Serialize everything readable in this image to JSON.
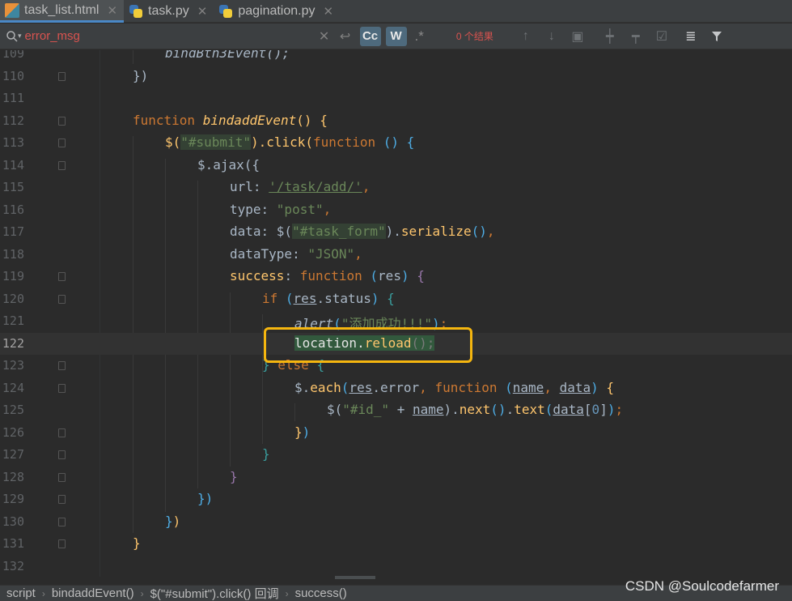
{
  "tabs": [
    {
      "label": "task_list.html",
      "icon": "html-file-icon",
      "active": true
    },
    {
      "label": "task.py",
      "icon": "python-file-icon",
      "active": false
    },
    {
      "label": "pagination.py",
      "icon": "python-file-icon",
      "active": false
    }
  ],
  "search": {
    "query": "error_msg",
    "match_case": "Cc",
    "whole_words": "W",
    "regex": ".*",
    "result_count": "0 个结果"
  },
  "editor": {
    "current_line": "122",
    "line_numbers": [
      "109",
      "110",
      "111",
      "112",
      "113",
      "114",
      "115",
      "116",
      "117",
      "118",
      "119",
      "120",
      "121",
      "122",
      "123",
      "124",
      "125",
      "126",
      "127",
      "128",
      "129",
      "130",
      "131",
      "132"
    ],
    "code": {
      "l109": "bindBtn3Event();",
      "l110": "})",
      "l112_kw": "function",
      "l112_name": "bindaddEvent",
      "l112_rest": "() {",
      "l113_a": "$(",
      "l113_str": "\"#submit\"",
      "l113_b": ").click(",
      "l113_kw": "function",
      "l113_c": " () {",
      "l114": "$.ajax({",
      "l115_key": "url",
      "l115_str": "'/task/add/'",
      "l116_key": "type",
      "l116_str": "\"post\"",
      "l117_key": "data",
      "l117_str": "\"#task_form\"",
      "l117_fn": "serialize",
      "l118_key": "dataType",
      "l118_str": "\"JSON\"",
      "l119_key": "success",
      "l119_kw": "function",
      "l119_param": "res",
      "l120_kw": "if",
      "l120_obj": "res",
      "l120_prop": "status",
      "l121_fn": "alert",
      "l121_str": "\"添加成功!!!\"",
      "l122_obj": "location",
      "l122_fn": "reload",
      "l123_kw": "else",
      "l124_fn": "each",
      "l124_obj": "res",
      "l124_prop": "error",
      "l124_kw": "function",
      "l124_p1": "name",
      "l124_p2": "data",
      "l125_str": "\"#id_\"",
      "l125_var": "name",
      "l125_fn1": "next",
      "l125_fn2": "text",
      "l125_arr": "data",
      "l125_idx": "0"
    }
  },
  "breadcrumbs": [
    "script",
    "bindaddEvent()",
    "$(\"#submit\").click() 回调",
    "success()"
  ],
  "watermark": "CSDN @Soulcodefarmer",
  "colors": {
    "background": "#2b2b2b",
    "keyword": "#cc7832",
    "string": "#6a8759",
    "function": "#ffc66d",
    "highlight_box": "#f5b60f",
    "search_text": "#d9534f"
  }
}
